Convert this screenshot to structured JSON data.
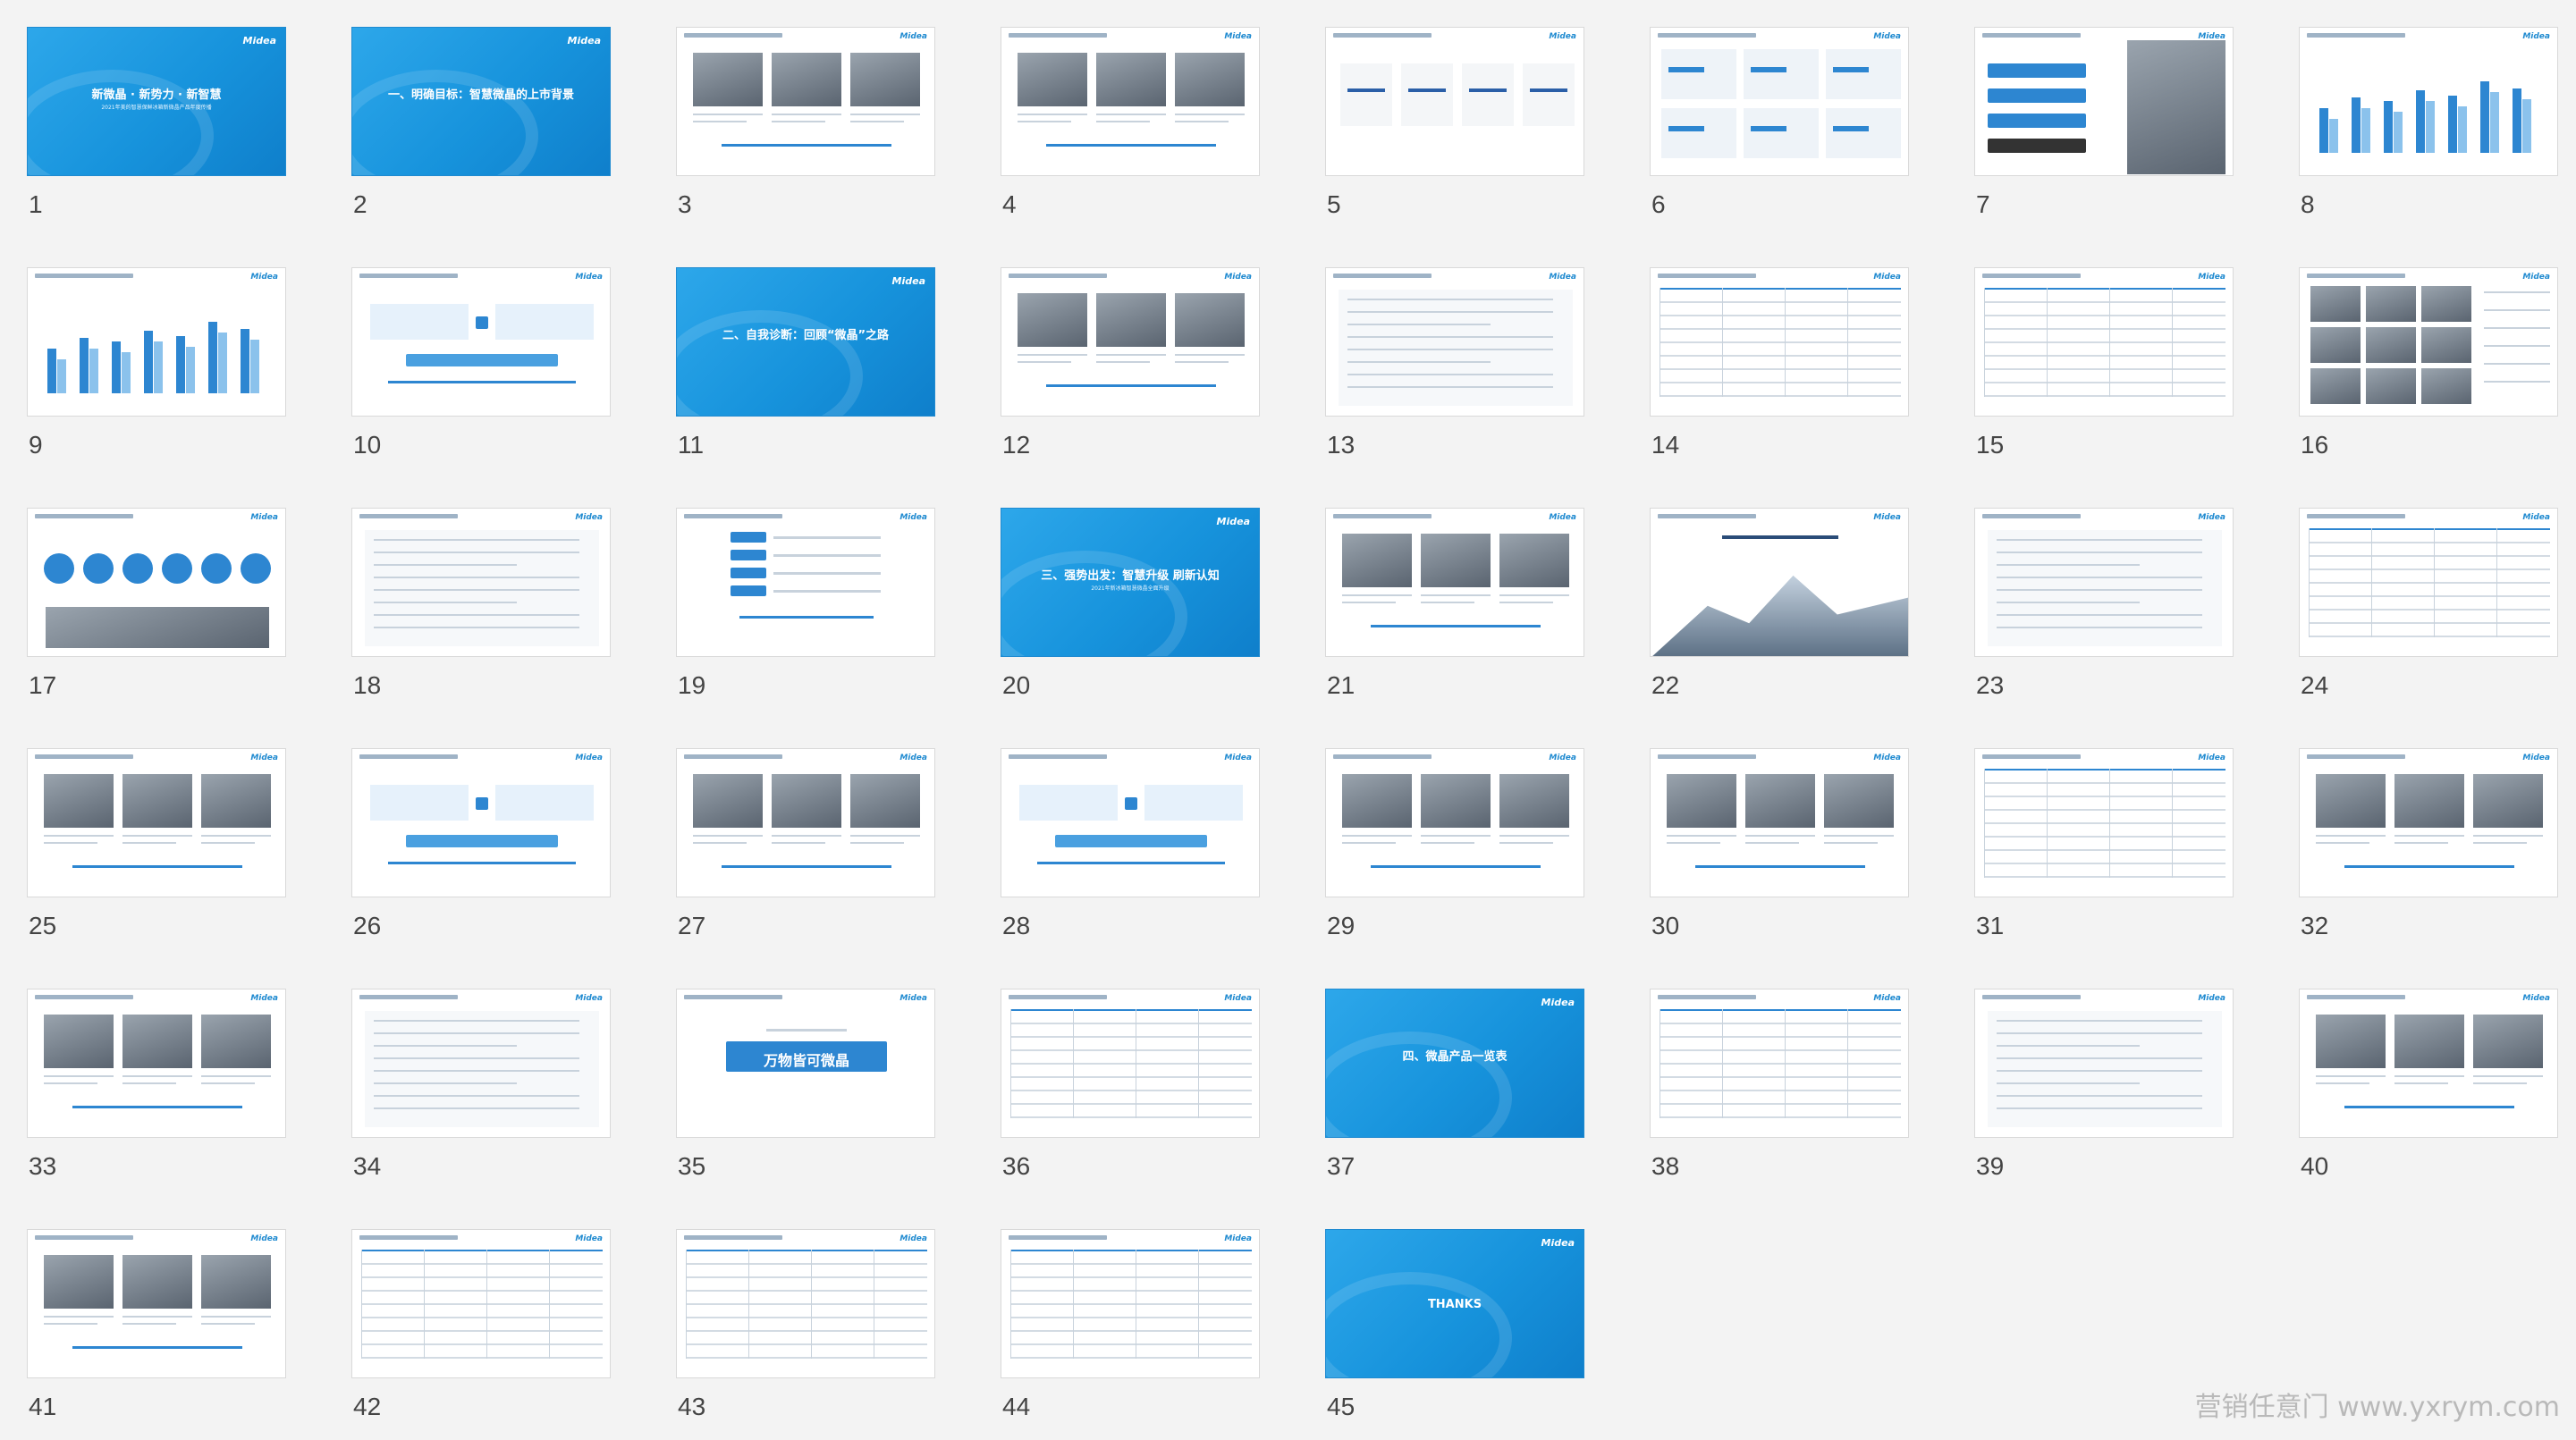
{
  "slides": [
    {
      "n": "1",
      "style": "cover",
      "title": "新微晶 · 新势力 · 新智慧",
      "subtitle": "2021年美的智慧保鲜冰箱新微晶产品年度传播"
    },
    {
      "n": "2",
      "style": "section",
      "title": "一、明确目标：智慧微晶的上市背景"
    },
    {
      "n": "3",
      "style": "photos3"
    },
    {
      "n": "4",
      "style": "photos3"
    },
    {
      "n": "5",
      "style": "brands"
    },
    {
      "n": "6",
      "style": "stats"
    },
    {
      "n": "7",
      "style": "person"
    },
    {
      "n": "8",
      "style": "bars"
    },
    {
      "n": "9",
      "style": "bars"
    },
    {
      "n": "10",
      "style": "flow"
    },
    {
      "n": "11",
      "style": "section",
      "title": "二、自我诊断：回顾“微晶”之路"
    },
    {
      "n": "12",
      "style": "photos3"
    },
    {
      "n": "13",
      "style": "text"
    },
    {
      "n": "14",
      "style": "table"
    },
    {
      "n": "15",
      "style": "table"
    },
    {
      "n": "16",
      "style": "photogrid"
    },
    {
      "n": "17",
      "style": "circles"
    },
    {
      "n": "18",
      "style": "text"
    },
    {
      "n": "19",
      "style": "list"
    },
    {
      "n": "20",
      "style": "section",
      "title": "三、强势出发：智慧升级 刷新认知",
      "subtitle": "2021年新冰箱智慧微晶全面升级"
    },
    {
      "n": "21",
      "style": "photos3"
    },
    {
      "n": "22",
      "style": "mountain"
    },
    {
      "n": "23",
      "style": "text"
    },
    {
      "n": "24",
      "style": "table"
    },
    {
      "n": "25",
      "style": "photos3"
    },
    {
      "n": "26",
      "style": "flow"
    },
    {
      "n": "27",
      "style": "photos3"
    },
    {
      "n": "28",
      "style": "flow"
    },
    {
      "n": "29",
      "style": "photos3"
    },
    {
      "n": "30",
      "style": "photos3"
    },
    {
      "n": "31",
      "style": "table"
    },
    {
      "n": "32",
      "style": "photos3"
    },
    {
      "n": "33",
      "style": "photos3"
    },
    {
      "n": "34",
      "style": "text"
    },
    {
      "n": "35",
      "style": "banner",
      "title": "万物皆可微晶"
    },
    {
      "n": "36",
      "style": "table"
    },
    {
      "n": "37",
      "style": "section",
      "title": "四、微晶产品一览表"
    },
    {
      "n": "38",
      "style": "table"
    },
    {
      "n": "39",
      "style": "text"
    },
    {
      "n": "40",
      "style": "photos3"
    },
    {
      "n": "41",
      "style": "photos3"
    },
    {
      "n": "42",
      "style": "table"
    },
    {
      "n": "43",
      "style": "table"
    },
    {
      "n": "44",
      "style": "table"
    },
    {
      "n": "45",
      "style": "section",
      "title": "THANKS"
    }
  ],
  "brand": "Midea",
  "watermark": "营销任意门 www.yxrym.com"
}
